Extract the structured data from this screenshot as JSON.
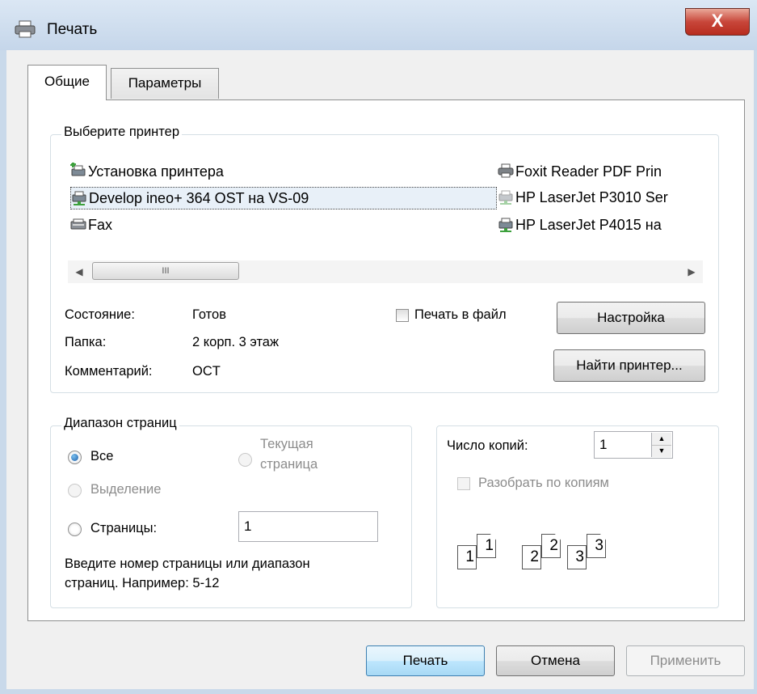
{
  "window": {
    "title": "Печать",
    "close_glyph": "X"
  },
  "tabs": [
    {
      "label": "Общие",
      "selected": true
    },
    {
      "label": "Параметры",
      "selected": false
    }
  ],
  "printer_group": {
    "legend": "Выберите принтер",
    "printers": [
      {
        "name": "Установка принтера",
        "icon": "add-printer-icon",
        "selected": false
      },
      {
        "name": "Develop ineo+ 364 OST на VS-09",
        "icon": "network-printer-icon",
        "selected": true
      },
      {
        "name": "Fax",
        "icon": "fax-icon",
        "selected": false
      },
      {
        "name": "Foxit Reader PDF Prin",
        "icon": "printer-icon",
        "selected": false
      },
      {
        "name": "HP LaserJet P3010 Ser",
        "icon": "network-printer-disabled-icon",
        "selected": false
      },
      {
        "name": "HP LaserJet P4015 на",
        "icon": "network-printer-icon",
        "selected": false
      }
    ],
    "scroll_thumb_glyph": "III",
    "status_label": "Состояние:",
    "status_value": "Готов",
    "folder_label": "Папка:",
    "folder_value": "2 корп. 3 этаж",
    "comment_label": "Комментарий:",
    "comment_value": "OCT",
    "print_to_file_label": "Печать в файл",
    "print_to_file_checked": false,
    "settings_button": "Настройка",
    "find_printer_button": "Найти принтер..."
  },
  "range_group": {
    "legend": "Диапазон страниц",
    "all_label": "Все",
    "all_checked": true,
    "current_page_label_line1": "Текущая",
    "current_page_label_line2": "страница",
    "selection_label": "Выделение",
    "pages_label": "Страницы:",
    "pages_value": "1",
    "hint_line1": "Введите номер страницы или диапазон",
    "hint_line2": "страниц.  Например: 5-12"
  },
  "copies_group": {
    "copies_label": "Число копий:",
    "copies_value": "1",
    "collate_label": "Разобрать по копиям",
    "collate_checked": false,
    "collate_pages": [
      "1",
      "1",
      "2",
      "2",
      "3",
      "3"
    ]
  },
  "footer": {
    "print_button": "Печать",
    "cancel_button": "Отмена",
    "apply_button": "Применить"
  },
  "colors": {
    "accent": "#3c7fb1",
    "close_button": "#c8463a",
    "frame": "#c9d9ea",
    "dialog_bg": "#f0f0f0"
  }
}
